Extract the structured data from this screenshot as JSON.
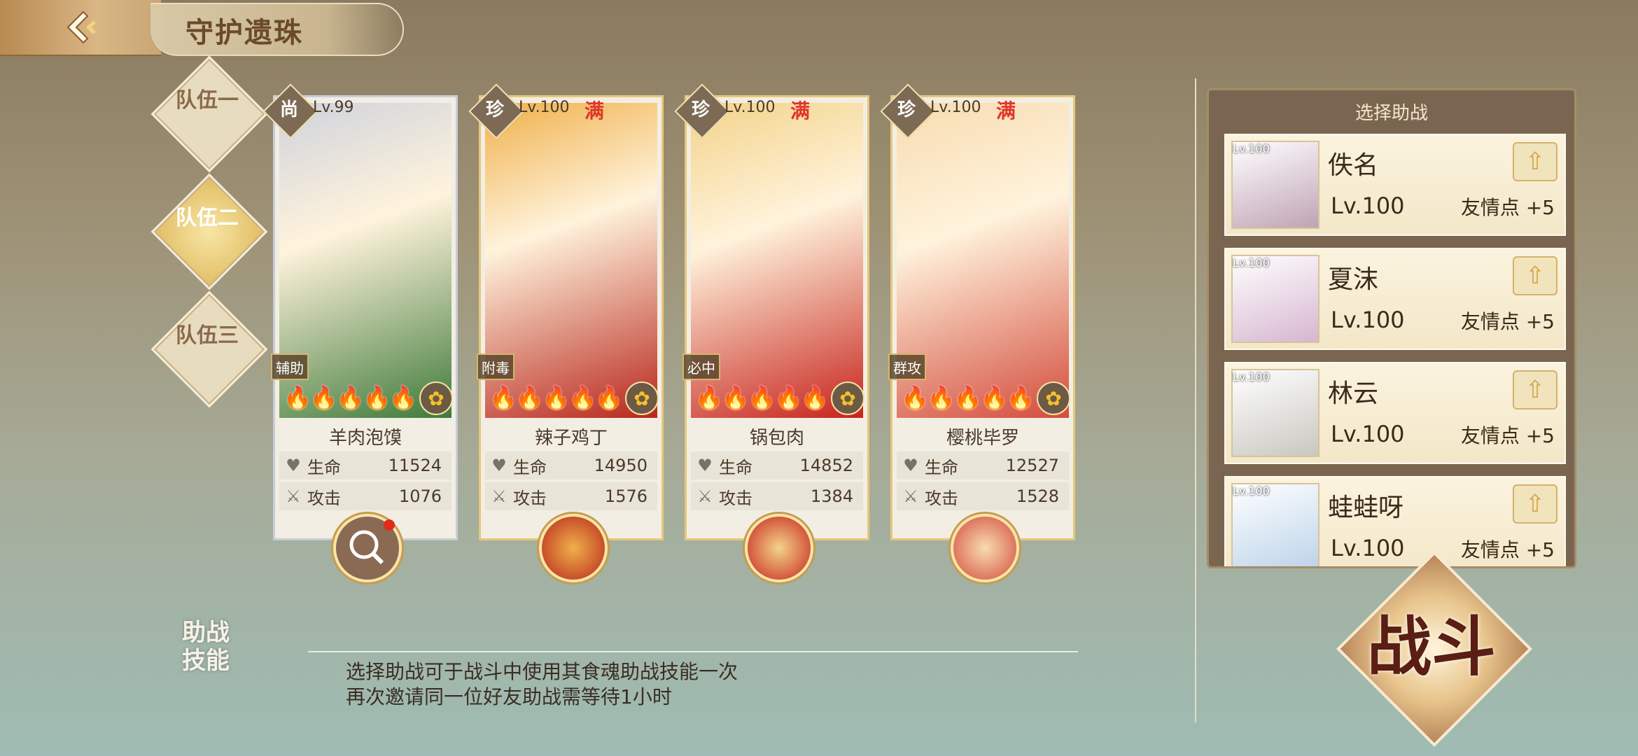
{
  "header": {
    "title": "守护遗珠"
  },
  "teams": [
    {
      "label": "队伍一",
      "active": false
    },
    {
      "label": "队伍二",
      "active": true
    },
    {
      "label": "队伍三",
      "active": false
    }
  ],
  "cards": [
    {
      "name": "羊肉泡馍",
      "rarity": "尚",
      "level": "Lv.99",
      "full": "",
      "role": "辅助",
      "stars": "🔥🔥🔥🔥🔥",
      "hp_label": "生命",
      "hp": "11524",
      "atk_label": "攻击",
      "atk": "1076",
      "colors": {
        "art": "#cfd3dc",
        "accent": "#3f7a3a"
      }
    },
    {
      "name": "辣子鸡丁",
      "rarity": "珍",
      "level": "Lv.100",
      "full": "满",
      "role": "附毒",
      "stars": "🔥🔥🔥🔥🔥",
      "hp_label": "生命",
      "hp": "14950",
      "atk_label": "攻击",
      "atk": "1576",
      "colors": {
        "art": "#f0b04a",
        "accent": "#b8261c"
      }
    },
    {
      "name": "锅包肉",
      "rarity": "珍",
      "level": "Lv.100",
      "full": "满",
      "role": "必中",
      "stars": "🔥🔥🔥🔥🔥",
      "hp_label": "生命",
      "hp": "14852",
      "atk_label": "攻击",
      "atk": "1384",
      "colors": {
        "art": "#f3d38a",
        "accent": "#c7231c"
      }
    },
    {
      "name": "樱桃毕罗",
      "rarity": "珍",
      "level": "Lv.100",
      "full": "满",
      "role": "群攻",
      "stars": "🔥🔥🔥🔥🔥",
      "hp_label": "生命",
      "hp": "12527",
      "atk_label": "攻击",
      "atk": "1528",
      "colors": {
        "art": "#f7dcb0",
        "accent": "#d44b3c"
      }
    }
  ],
  "assist": {
    "title": "选择助战",
    "friends": [
      {
        "name": "佚名",
        "level": "Lv.100",
        "tag": "Lv.100",
        "points": "友情点 +5",
        "color": "#bfa3b5"
      },
      {
        "name": "夏沫",
        "level": "Lv.100",
        "tag": "Lv.100",
        "points": "友情点 +5",
        "color": "#d6b6d0"
      },
      {
        "name": "林云",
        "level": "Lv.100",
        "tag": "Lv.100",
        "points": "友情点 +5",
        "color": "#c9c7c0"
      },
      {
        "name": "蛙蛙呀",
        "level": "Lv.100",
        "tag": "Lv.100",
        "points": "友情点 +5",
        "color": "#bcd3ea"
      }
    ]
  },
  "battle": {
    "label": "战斗"
  },
  "assist_skill": {
    "title": "助战技能",
    "desc_line1": "选择助战可于战斗中使用其食魂助战技能一次",
    "desc_line2": "再次邀请同一位好友助战需等待1小时"
  },
  "icons": {
    "back": "back-arrow-icon",
    "heart": "heart-icon",
    "sword": "sword-icon",
    "search": "search-icon"
  }
}
